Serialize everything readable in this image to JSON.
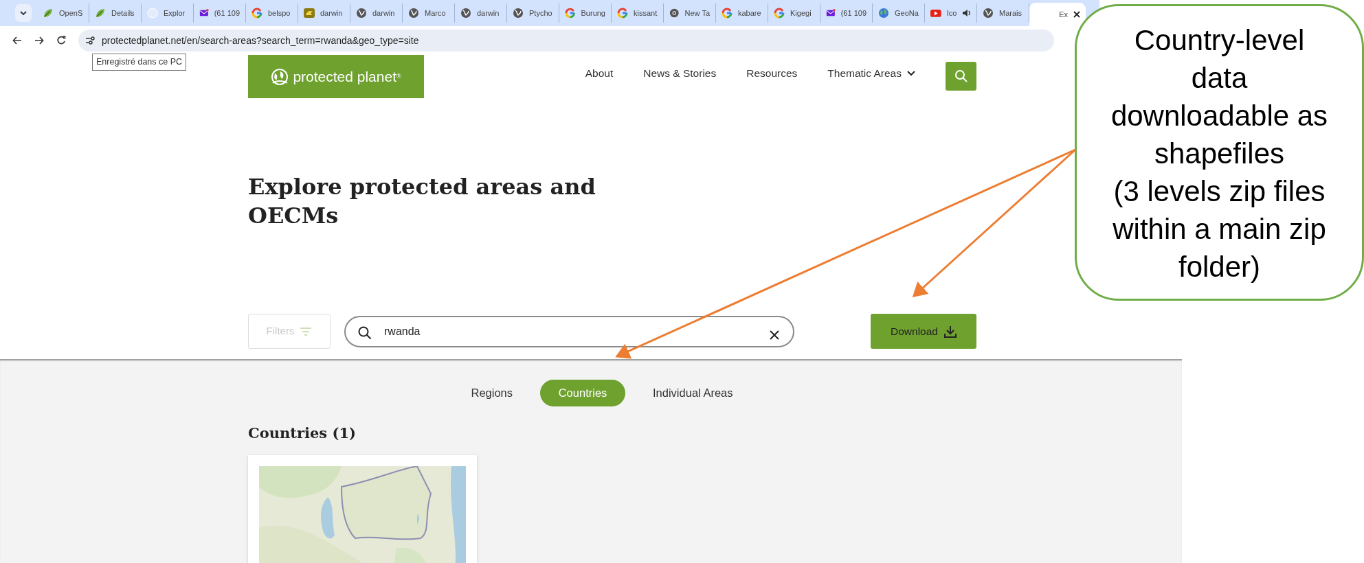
{
  "browser": {
    "tabs": [
      {
        "title": "OpenS",
        "kind": "leaf",
        "selected": false,
        "audio": false
      },
      {
        "title": "Details",
        "kind": "leaf",
        "selected": false,
        "audio": false
      },
      {
        "title": "Explor",
        "kind": "pale-globe",
        "selected": false,
        "audio": false
      },
      {
        "title": "(61 109",
        "kind": "mail",
        "selected": false,
        "audio": false
      },
      {
        "title": "belspo",
        "kind": "ring",
        "selected": false,
        "audio": false
      },
      {
        "title": "darwin",
        "kind": "badge",
        "selected": false,
        "audio": false
      },
      {
        "title": "darwin",
        "kind": "globe",
        "selected": false,
        "audio": false
      },
      {
        "title": "Marco",
        "kind": "globe",
        "selected": false,
        "audio": false
      },
      {
        "title": "darwin",
        "kind": "globe",
        "selected": false,
        "audio": false
      },
      {
        "title": "Ptycho",
        "kind": "globe",
        "selected": false,
        "audio": false
      },
      {
        "title": "Burung",
        "kind": "ring",
        "selected": false,
        "audio": false
      },
      {
        "title": "kissant",
        "kind": "ring",
        "selected": false,
        "audio": false
      },
      {
        "title": "New Ta",
        "kind": "circle",
        "selected": false,
        "audio": false
      },
      {
        "title": "kabare",
        "kind": "ring",
        "selected": false,
        "audio": false
      },
      {
        "title": "Kigegi",
        "kind": "ring",
        "selected": false,
        "audio": false
      },
      {
        "title": "(61 109",
        "kind": "mail",
        "selected": false,
        "audio": false
      },
      {
        "title": "GeoNa",
        "kind": "earth",
        "selected": false,
        "audio": false
      },
      {
        "title": "Ico",
        "kind": "play",
        "selected": false,
        "audio": true
      },
      {
        "title": "Marais",
        "kind": "globe",
        "selected": false,
        "audio": false
      },
      {
        "title": "Ex",
        "kind": "none",
        "selected": true,
        "audio": false
      }
    ],
    "address": "protectedplanet.net/en/search-areas?search_term=rwanda&geo_type=site",
    "tooltip": "Enregistré dans ce PC"
  },
  "site": {
    "logo": "protected planet$^{®}$",
    "nav": [
      {
        "label": "About",
        "dropdown": false
      },
      {
        "label": "News & Stories",
        "dropdown": false
      },
      {
        "label": "Resources",
        "dropdown": false
      },
      {
        "label": "Thematic Areas",
        "dropdown": true
      }
    ],
    "heading": "Explore protected areas and OECMs",
    "filters": {
      "label": "Filters",
      "disabled": true
    },
    "search": {
      "value": "rwanda"
    },
    "download": "Download",
    "result_tabs": [
      {
        "label": "Regions",
        "selected": false
      },
      {
        "label": "Countries",
        "selected": true
      },
      {
        "label": "Individual Areas",
        "selected": false
      }
    ],
    "results_heading": "Countries (1)"
  },
  "callout": {
    "lines": [
      "Country-level",
      "data",
      "downloadable as",
      "shapefiles",
      "(3 levels zip files",
      "within a main zip",
      "folder)"
    ]
  }
}
